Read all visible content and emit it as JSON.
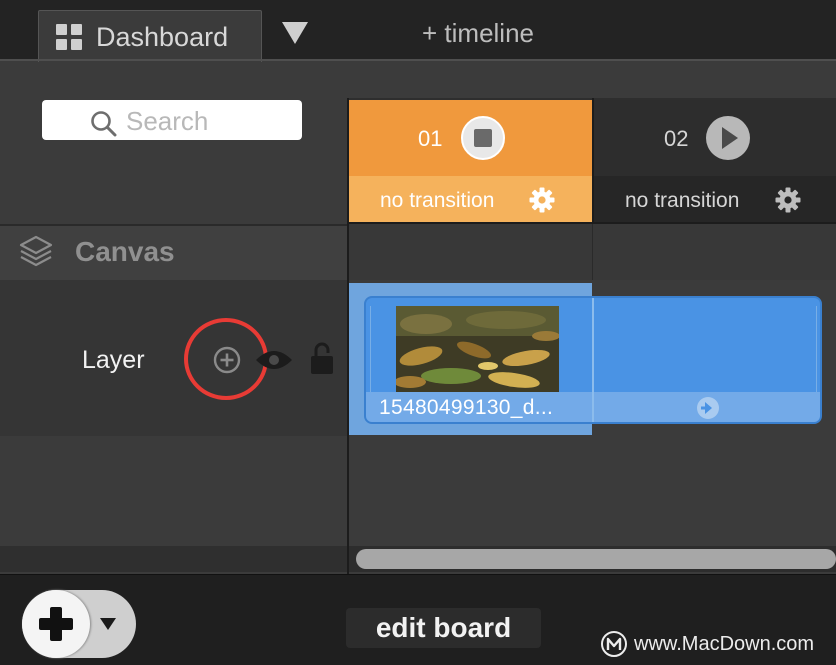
{
  "header": {
    "tab_label": "Dashboard",
    "add_timeline": "+ timeline"
  },
  "search": {
    "placeholder": "Search",
    "value": ""
  },
  "layers_panel": {
    "section_title": "Canvas",
    "layer_name": "Layer"
  },
  "cues": [
    {
      "number": "01",
      "transition": "no transition",
      "state": "playing",
      "control_icon": "stop-icon"
    },
    {
      "number": "02",
      "transition": "no transition",
      "state": "idle",
      "control_icon": "play-icon"
    }
  ],
  "clip": {
    "name": "15480499130_d..."
  },
  "footer": {
    "edit_board_label": "edit board",
    "watermark": "www.MacDown.com"
  },
  "colors": {
    "active_cue": "#f0993d",
    "clip_blue": "#4a93e4",
    "highlight_red": "#e83b35"
  },
  "icons": [
    "dashboard-grid-icon",
    "dropdown-arrow-icon",
    "search-icon",
    "layers-icon",
    "add-layer-icon",
    "eye-icon",
    "lock-icon",
    "stop-icon",
    "play-icon",
    "gear-icon",
    "arrow-right-icon",
    "plus-icon"
  ]
}
